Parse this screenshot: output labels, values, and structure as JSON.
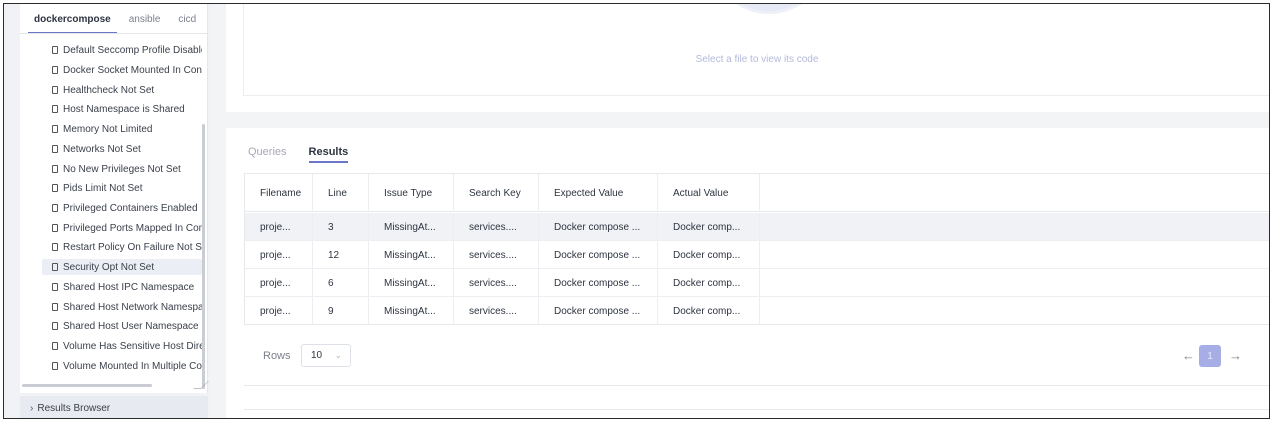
{
  "sidebar": {
    "tabs": [
      {
        "label": "dockercompose",
        "active": true
      },
      {
        "label": "ansible",
        "active": false
      },
      {
        "label": "cicd",
        "active": false
      }
    ],
    "items": [
      "Default Seccomp Profile Disable",
      "Docker Socket Mounted In Cont",
      "Healthcheck Not Set",
      "Host Namespace is Shared",
      "Memory Not Limited",
      "Networks Not Set",
      "No New Privileges Not Set",
      "Pids Limit Not Set",
      "Privileged Containers Enabled",
      "Privileged Ports Mapped In Con",
      "Restart Policy On Failure Not Se",
      "Security Opt Not Set",
      "Shared Host IPC Namespace",
      "Shared Host Network Namespa",
      "Shared Host User Namespace",
      "Volume Has Sensitive Host Dire",
      "Volume Mounted In Multiple Cor"
    ],
    "selected_item": "Security Opt Not Set",
    "results_browser_label": "Results Browser"
  },
  "code_viewer": {
    "hint": "Select a file to view its code"
  },
  "results": {
    "tabs": [
      {
        "label": "Queries",
        "active": false
      },
      {
        "label": "Results",
        "active": true
      }
    ],
    "columns": [
      "Filename",
      "Line",
      "Issue Type",
      "Search Key",
      "Expected Value",
      "Actual Value"
    ],
    "rows": [
      [
        "proje...",
        "3",
        "MissingAt...",
        "services....",
        "Docker compose ...",
        "Docker comp..."
      ],
      [
        "proje...",
        "12",
        "MissingAt...",
        "services....",
        "Docker compose ...",
        "Docker comp..."
      ],
      [
        "proje...",
        "6",
        "MissingAt...",
        "services....",
        "Docker compose ...",
        "Docker comp..."
      ],
      [
        "proje...",
        "9",
        "MissingAt...",
        "services....",
        "Docker compose ...",
        "Docker comp..."
      ]
    ],
    "pagination": {
      "rows_label": "Rows",
      "rows_value": "10",
      "current_page": "1",
      "prev_icon": "arrow-left-icon",
      "next_icon": "arrow-right-icon"
    }
  },
  "colors": {
    "accent": "#6a77c9",
    "page_active_bg": "#a7aee6",
    "hint_text": "#b3badb"
  }
}
